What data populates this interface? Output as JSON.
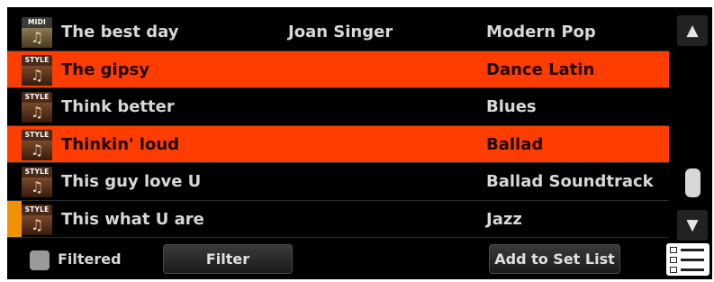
{
  "song_list": [
    {
      "badge": "MIDI",
      "title": "The best day",
      "artist": "Joan Singer",
      "genre": "Modern Pop",
      "highlighted": false,
      "current": false
    },
    {
      "badge": "STYLE",
      "title": "The gipsy",
      "artist": "",
      "genre": "Dance Latin",
      "highlighted": true,
      "current": false
    },
    {
      "badge": "STYLE",
      "title": "Think better",
      "artist": "",
      "genre": "Blues",
      "highlighted": false,
      "current": false
    },
    {
      "badge": "STYLE",
      "title": "Thinkin' loud",
      "artist": "",
      "genre": "Ballad",
      "highlighted": true,
      "current": false
    },
    {
      "badge": "STYLE",
      "title": "This guy love U",
      "artist": "",
      "genre": "Ballad Soundtrack",
      "highlighted": false,
      "current": false
    },
    {
      "badge": "STYLE",
      "title": "This what U are",
      "artist": "",
      "genre": "Jazz",
      "highlighted": false,
      "current": true
    }
  ],
  "scrollbar": {
    "up_icon": "▲",
    "down_icon": "▼"
  },
  "bottom_bar": {
    "filtered_label": "Filtered",
    "filtered_checked": false,
    "filter_button": "Filter",
    "add_to_set_list_button": "Add to Set List",
    "menu_icon": "checklist-menu-icon"
  },
  "colors": {
    "highlight": "#ff3d00",
    "current_marker": "#f39200",
    "background": "#000000",
    "text": "#d8d8d8"
  }
}
